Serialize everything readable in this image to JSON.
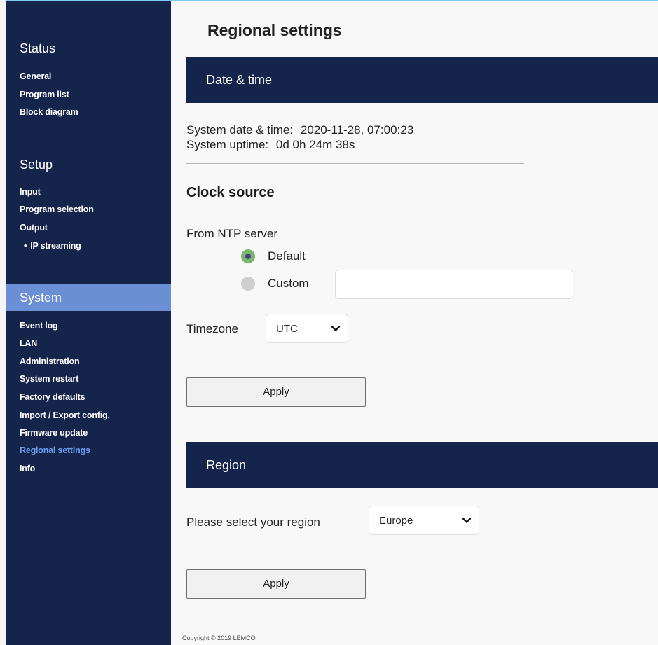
{
  "sidebar": {
    "sections": [
      {
        "title": "Status",
        "items": [
          "General",
          "Program list",
          "Block diagram"
        ]
      },
      {
        "title": "Setup",
        "items": [
          "Input",
          "Program selection",
          "Output",
          "IP streaming"
        ]
      },
      {
        "title": "System",
        "items": [
          "Event log",
          "LAN",
          "Administration",
          "System restart",
          "Factory defaults",
          "Import / Export config.",
          "Firmware update",
          "Regional settings",
          "Info"
        ]
      }
    ],
    "active_section": "System",
    "current_item": "Regional settings"
  },
  "page": {
    "title": "Regional settings"
  },
  "date_time": {
    "band_title": "Date & time",
    "system_date_label": "System date & time:",
    "system_date_value": "2020-11-28, 07:00:23",
    "uptime_label": "System uptime:",
    "uptime_value": "0d 0h 24m 38s"
  },
  "clock_source": {
    "title": "Clock source",
    "ntp_label": "From NTP server",
    "options": [
      {
        "label": "Default",
        "selected": true
      },
      {
        "label": "Custom",
        "selected": false
      }
    ],
    "custom_value": "",
    "timezone_label": "Timezone",
    "timezone_value": "UTC",
    "apply_label": "Apply"
  },
  "region": {
    "band_title": "Region",
    "select_label": "Please select your region",
    "selected_region": "Europe",
    "apply_label": "Apply"
  },
  "footer": {
    "copyright": "Copyright © 2019 LEMCO"
  },
  "colors": {
    "navy": "#15244a",
    "active_section": "#6b8fd4",
    "current_item": "#6b9cf0",
    "radio_selected": "#7bb76a",
    "radio_dot": "#4a3a8e"
  }
}
